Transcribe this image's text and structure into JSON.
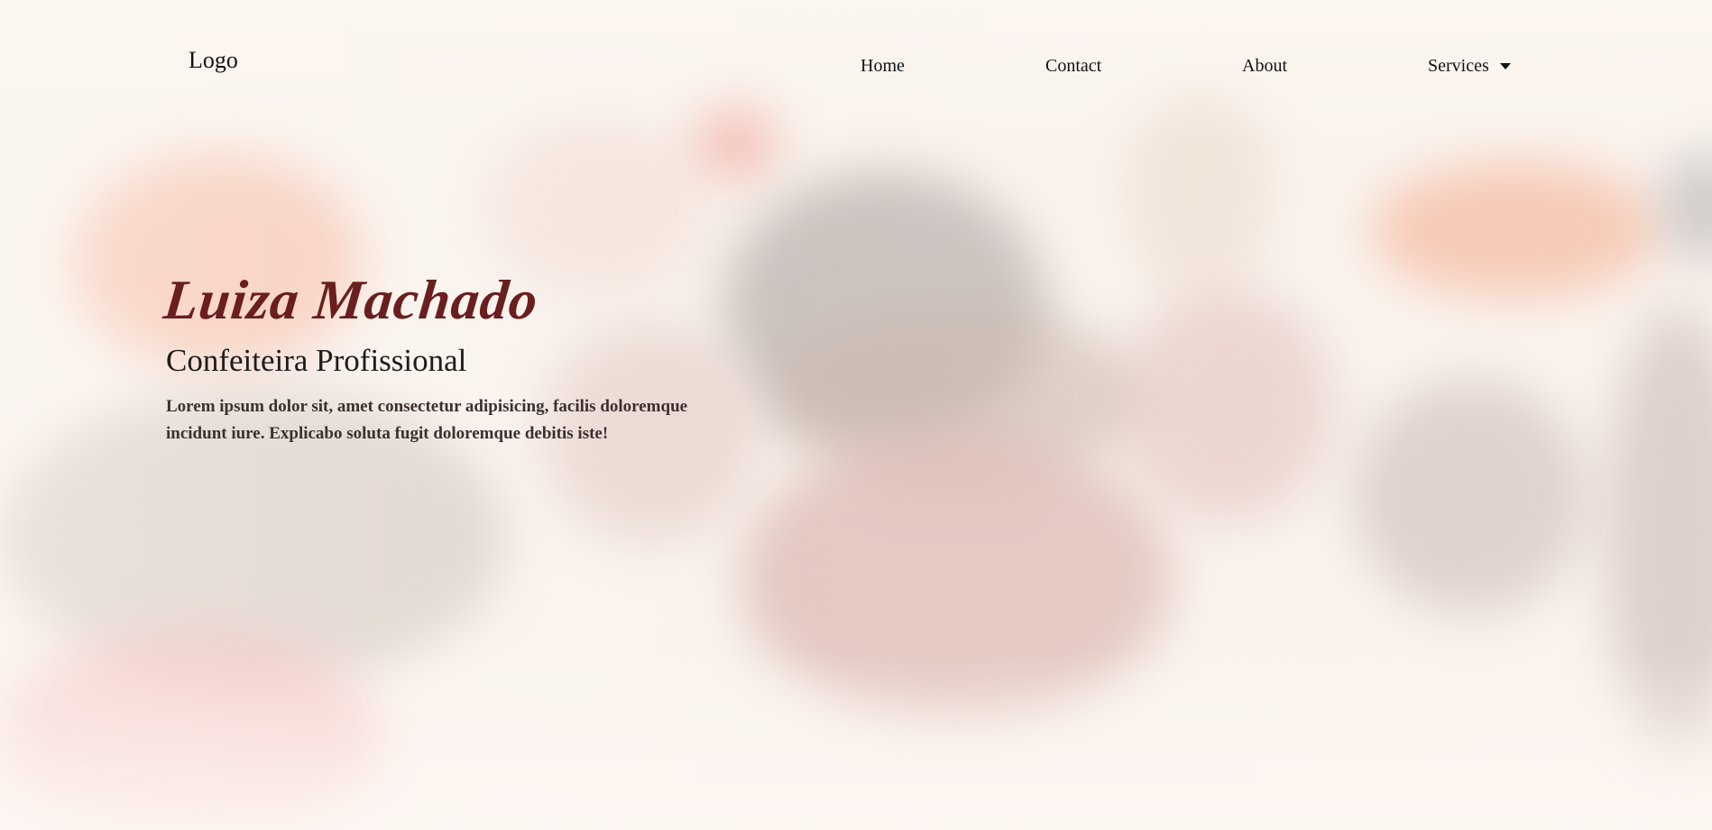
{
  "header": {
    "logo": "Logo",
    "nav": [
      {
        "label": "Home"
      },
      {
        "label": "Contact"
      },
      {
        "label": "About"
      },
      {
        "label": "Services",
        "icon": "caret-down-icon"
      }
    ]
  },
  "hero": {
    "name": "Luiza Machado",
    "role": "Confeiteira Profissional",
    "description": "Lorem ipsum dolor sit, amet consectetur adipisicing, facilis doloremque incidunt iure. Explicabo soluta fugit doloremque debitis iste!"
  },
  "colors": {
    "name_accent": "#6a1e1e",
    "text": "#111111"
  }
}
